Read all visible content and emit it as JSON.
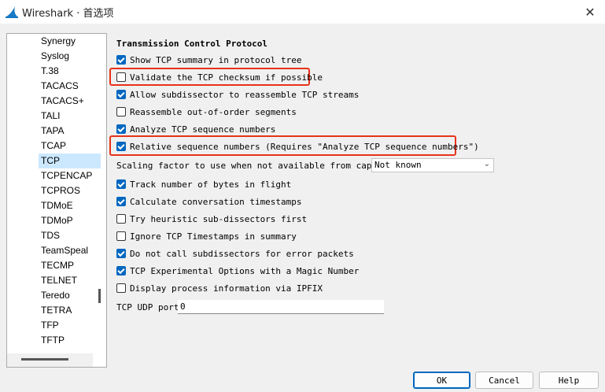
{
  "window": {
    "title": "Wireshark · 首选项"
  },
  "sidebar": {
    "items": [
      "Synergy",
      "Syslog",
      "T.38",
      "TACACS",
      "TACACS+",
      "TALI",
      "TAPA",
      "TCAP",
      "TCP",
      "TCPENCAP",
      "TCPROS",
      "TDMoE",
      "TDMoP",
      "TDS",
      "TeamSpeal",
      "TECMP",
      "TELNET",
      "Teredo",
      "TETRA",
      "TFP",
      "TFTP"
    ],
    "selected": "TCP"
  },
  "panel": {
    "section_title": "Transmission Control Protocol",
    "options": [
      {
        "label": "Show TCP summary in protocol tree",
        "checked": true
      },
      {
        "label": "Validate the TCP checksum if possible",
        "checked": false
      },
      {
        "label": "Allow subdissector to reassemble TCP streams",
        "checked": true
      },
      {
        "label": "Reassemble out-of-order segments",
        "checked": false
      },
      {
        "label": "Analyze TCP sequence numbers",
        "checked": true
      },
      {
        "label": "Relative sequence numbers (Requires \"Analyze TCP sequence numbers\")",
        "checked": true
      }
    ],
    "scaling": {
      "label": "Scaling factor to use when not available from capture",
      "value": "Not known"
    },
    "options2": [
      {
        "label": "Track number of bytes in flight",
        "checked": true
      },
      {
        "label": "Calculate conversation timestamps",
        "checked": true
      },
      {
        "label": "Try heuristic sub-dissectors first",
        "checked": false
      },
      {
        "label": "Ignore TCP Timestamps in summary",
        "checked": false
      },
      {
        "label": "Do not call subdissectors for error packets",
        "checked": true
      },
      {
        "label": "TCP Experimental Options with a Magic Number",
        "checked": true
      },
      {
        "label": "Display process information via IPFIX",
        "checked": false
      }
    ],
    "udp_port": {
      "label": "TCP UDP port",
      "value": "0"
    },
    "highlight_color": "#e8321a",
    "accent_color": "#0067c0"
  },
  "footer": {
    "ok": "OK",
    "cancel": "Cancel",
    "help": "Help"
  }
}
